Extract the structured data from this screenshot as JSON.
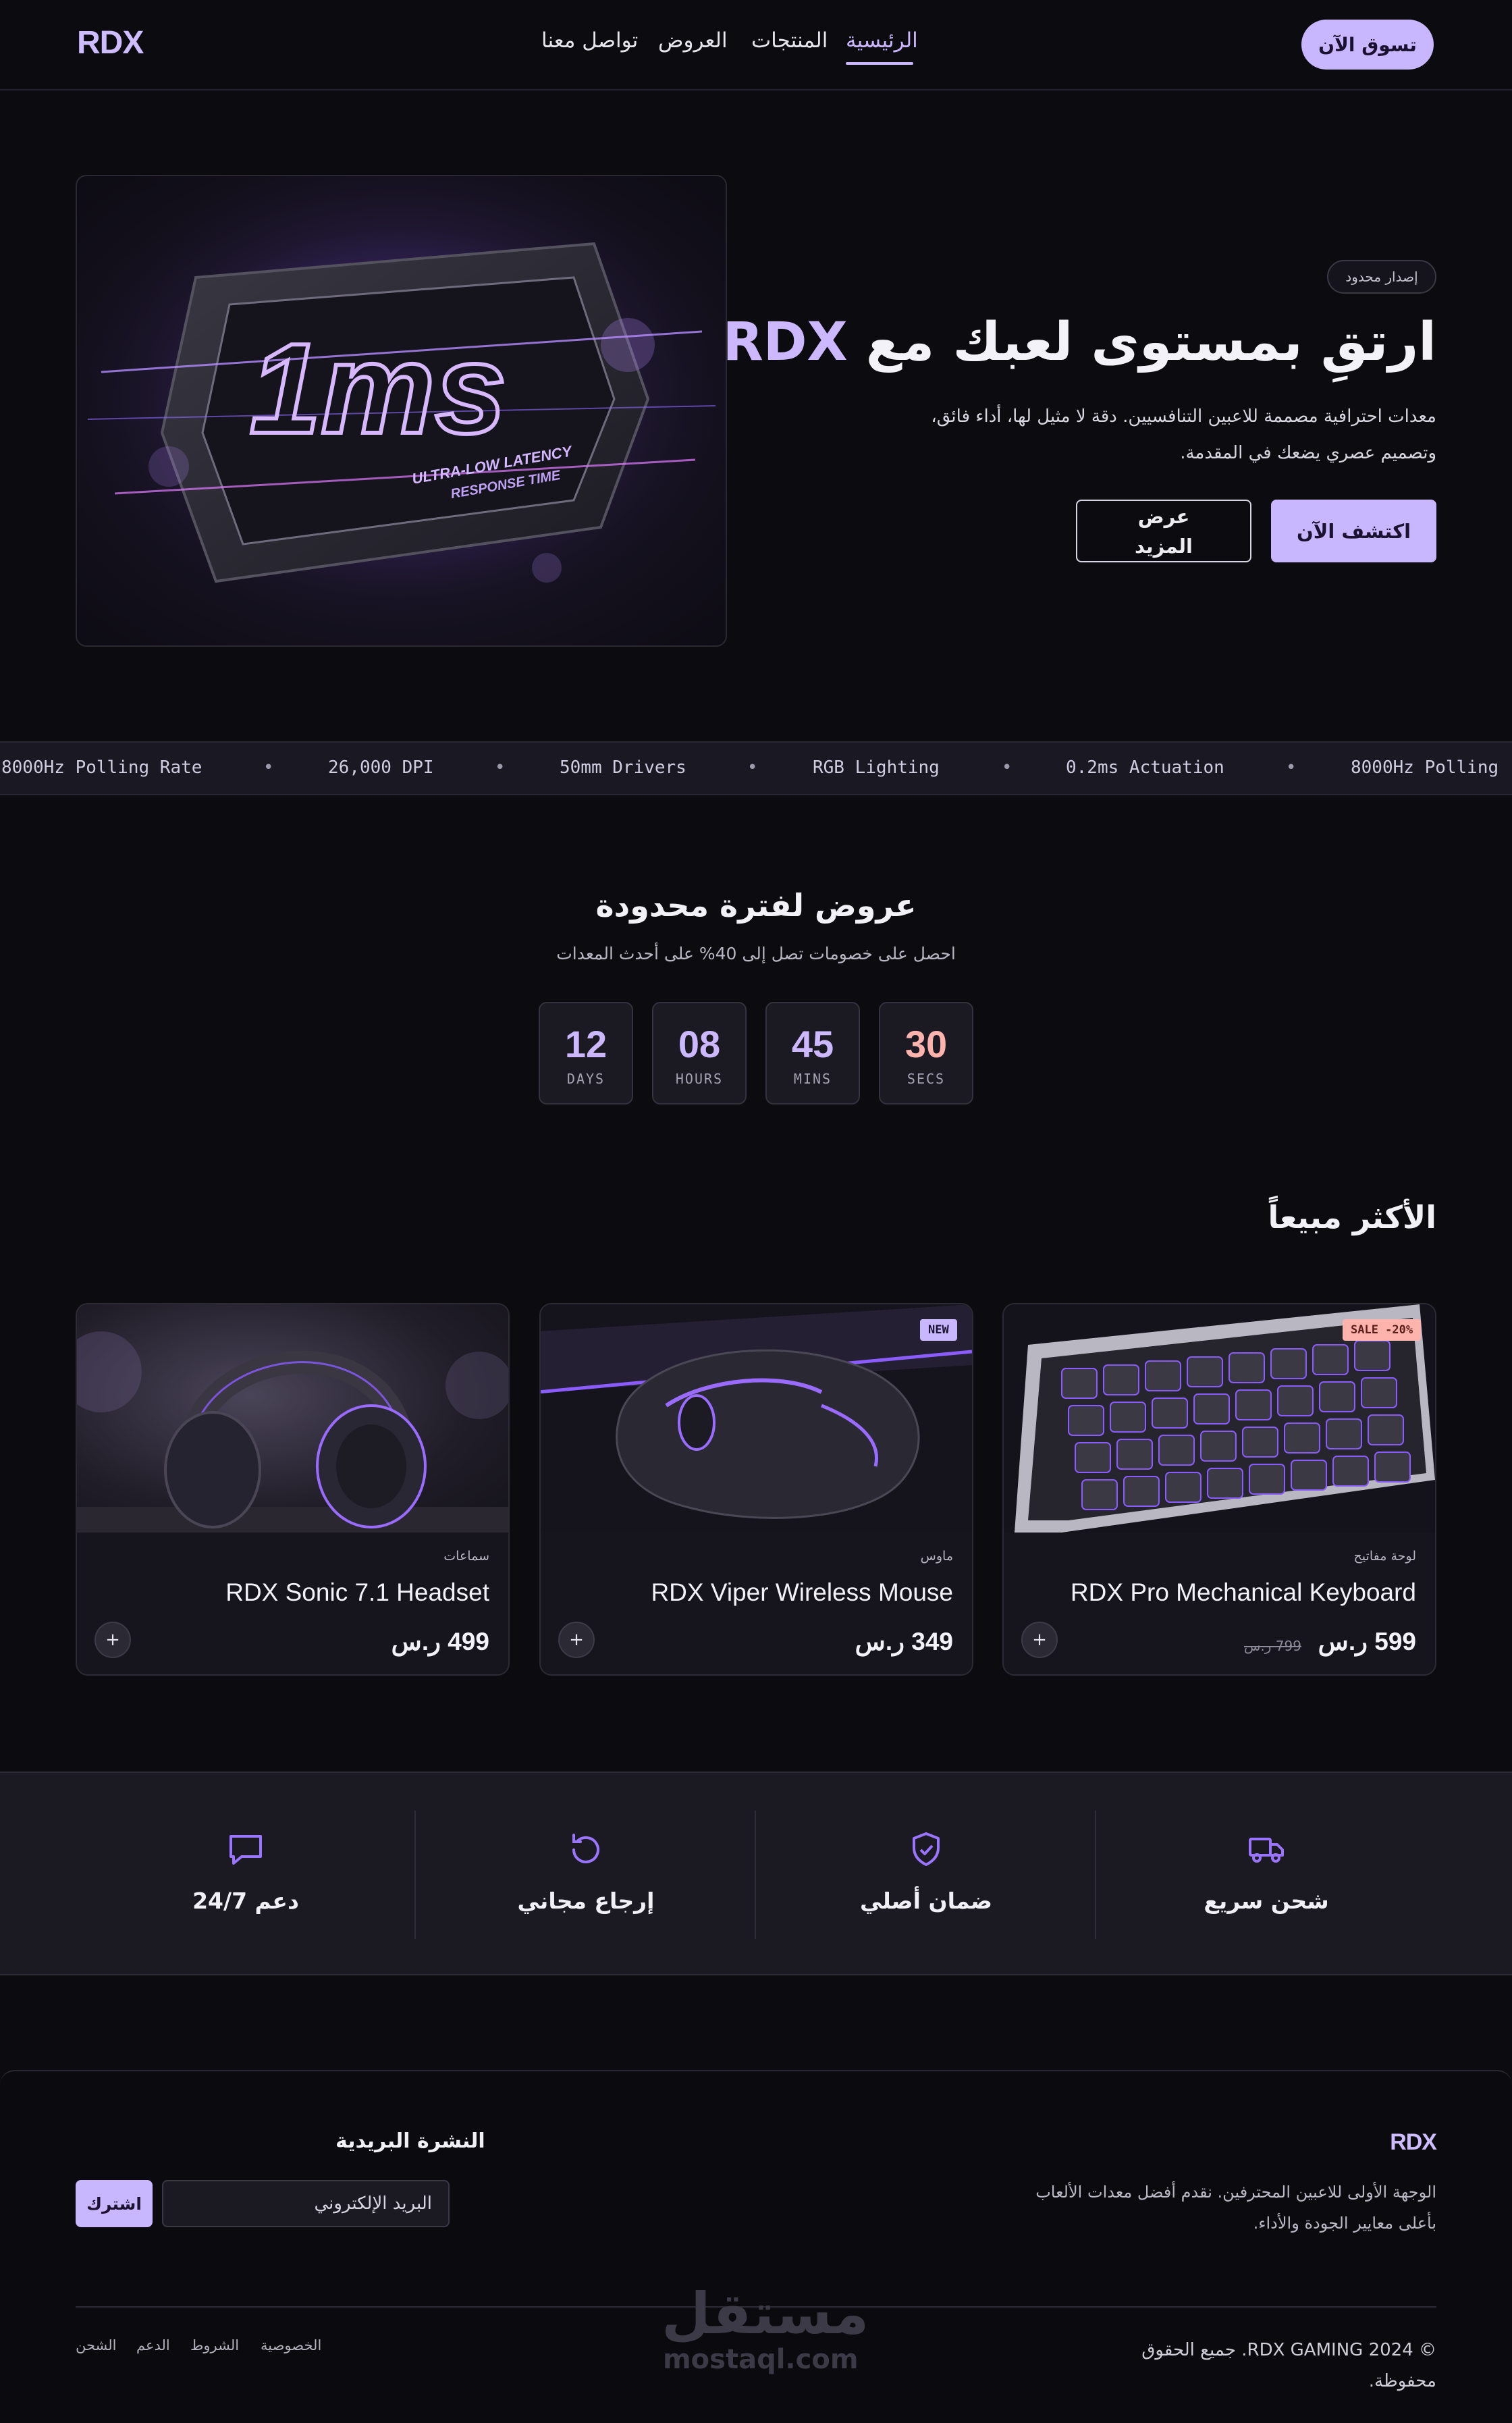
{
  "header": {
    "logo": "RDX",
    "nav": [
      "الرئيسية",
      "المنتجات",
      "العروض",
      "تواصل معنا"
    ],
    "active_nav": "الرئيسية",
    "cta": "تسوق الآن"
  },
  "hero": {
    "chip": "إصدار محدود",
    "title_prefix": "ارتقِ بمستوى لعبك مع",
    "title_brand": "RDX",
    "lead_line1": "معدات احترافية مصممة للاعبين التنافسيين. دقة لا مثيل لها، أداء فائق،",
    "lead_line2": "وتصميم عصري يضعك في المقدمة.",
    "btn_primary": "اكتشف الآن",
    "btn_secondary": "عرض المزيد",
    "image_text_big": "1ms",
    "image_text_small1": "ULTRA-LOW LATENCY",
    "image_text_small2": "RESPONSE TIME"
  },
  "ticker": [
    "8000Hz Polling Rate",
    "26,000 DPI",
    "50mm Drivers",
    "RGB Lighting",
    "0.2ms Actuation",
    "8000Hz Polling"
  ],
  "offers": {
    "title": "عروض لفترة محدودة",
    "subtitle": "احصل على خصومات تصل إلى 40% على أحدث المعدات",
    "countdown": [
      {
        "value": "12",
        "label": "DAYS"
      },
      {
        "value": "08",
        "label": "HOURS"
      },
      {
        "value": "45",
        "label": "MINS"
      },
      {
        "value": "30",
        "label": "SECS"
      }
    ]
  },
  "bestsellers": {
    "title": "الأكثر مبيعاً",
    "products": [
      {
        "category": "لوحة مفاتيح",
        "name": "RDX Pro Mechanical Keyboard",
        "price": "599 ر.س",
        "old_price": "799 ر.س",
        "badge": "SALE -20%"
      },
      {
        "category": "ماوس",
        "name": "RDX Viper Wireless Mouse",
        "price": "349 ر.س",
        "badge": "NEW"
      },
      {
        "category": "سماعات",
        "name": "RDX Sonic 7.1 Headset",
        "price": "499 ر.س"
      }
    ],
    "add_label": "+"
  },
  "features": [
    "شحن سريع",
    "ضمان أصلي",
    "إرجاع مجاني",
    "دعم 24/7"
  ],
  "footer": {
    "brand": "RDX",
    "desc_line1": "الوجهة الأولى للاعبين المحترفين. نقدم أفضل معدات الألعاب",
    "desc_line2": "بأعلى معايير الجودة والأداء.",
    "newsletter_title": "النشرة البريدية",
    "email_placeholder": "البريد الإلكتروني",
    "subscribe": "اشترك",
    "copyright_line1": "© 2024 RDX GAMING. جميع الحقوق",
    "copyright_line2": "محفوظة.",
    "links": [
      "الخصوصية",
      "الشروط",
      "الدعم",
      "الشحن"
    ],
    "watermark_ar": "مستقل",
    "watermark_en": "mostaql.com"
  },
  "colors": {
    "accent": "#c8b6ff",
    "background": "#0c0b10",
    "surface": "#1b1a22",
    "sale": "#ffb3ad"
  }
}
